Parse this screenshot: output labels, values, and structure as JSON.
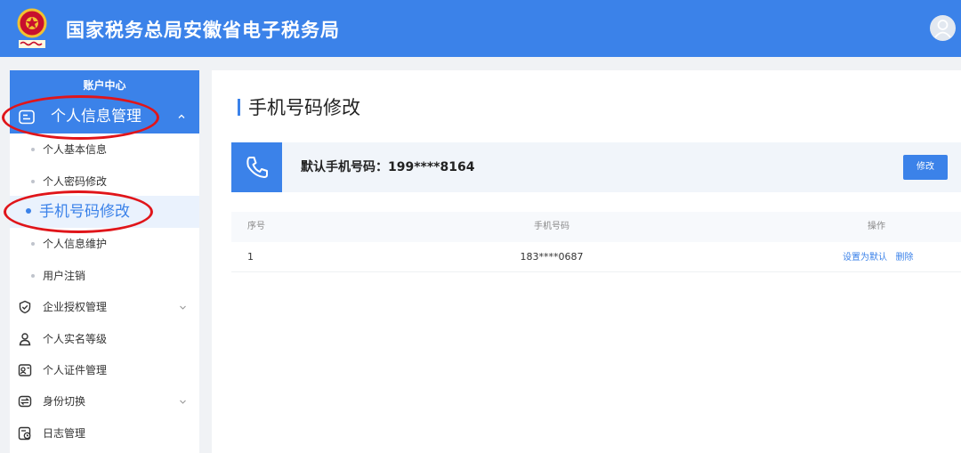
{
  "header": {
    "title": "国家税务总局安徽省电子税务局",
    "emblem_icon": "tax-emblem-icon",
    "avatar_icon": "user-avatar-icon"
  },
  "sidebar": {
    "heading": "账户中心",
    "group": {
      "label": "个人信息管理",
      "icon": "id-card-icon",
      "expanded": true,
      "items": [
        {
          "label": "个人基本信息",
          "active": false
        },
        {
          "label": "个人密码修改",
          "active": false
        },
        {
          "label": "手机号码修改",
          "active": true
        },
        {
          "label": "个人信息维护",
          "active": false
        },
        {
          "label": "用户注销",
          "active": false
        }
      ]
    },
    "menu": [
      {
        "label": "企业授权管理",
        "icon": "shield-check-icon",
        "has_children": true
      },
      {
        "label": "个人实名等级",
        "icon": "user-level-icon",
        "has_children": false
      },
      {
        "label": "个人证件管理",
        "icon": "certificate-icon",
        "has_children": false
      },
      {
        "label": "身份切换",
        "icon": "switch-identity-icon",
        "has_children": true
      },
      {
        "label": "日志管理",
        "icon": "log-icon",
        "has_children": false
      }
    ]
  },
  "main": {
    "title": "手机号码修改",
    "default_phone": {
      "label": "默认手机号码：199****8164",
      "icon": "phone-icon",
      "edit_label": "修改"
    },
    "table": {
      "columns": [
        "序号",
        "手机号码",
        "操作"
      ],
      "rows": [
        {
          "index": "1",
          "phone": "183****0687",
          "actions": [
            "设置为默认",
            "删除"
          ]
        }
      ]
    }
  },
  "colors": {
    "primary": "#3b82e9",
    "annotation": "#e0151a",
    "active_bg": "#eaf2fd"
  }
}
